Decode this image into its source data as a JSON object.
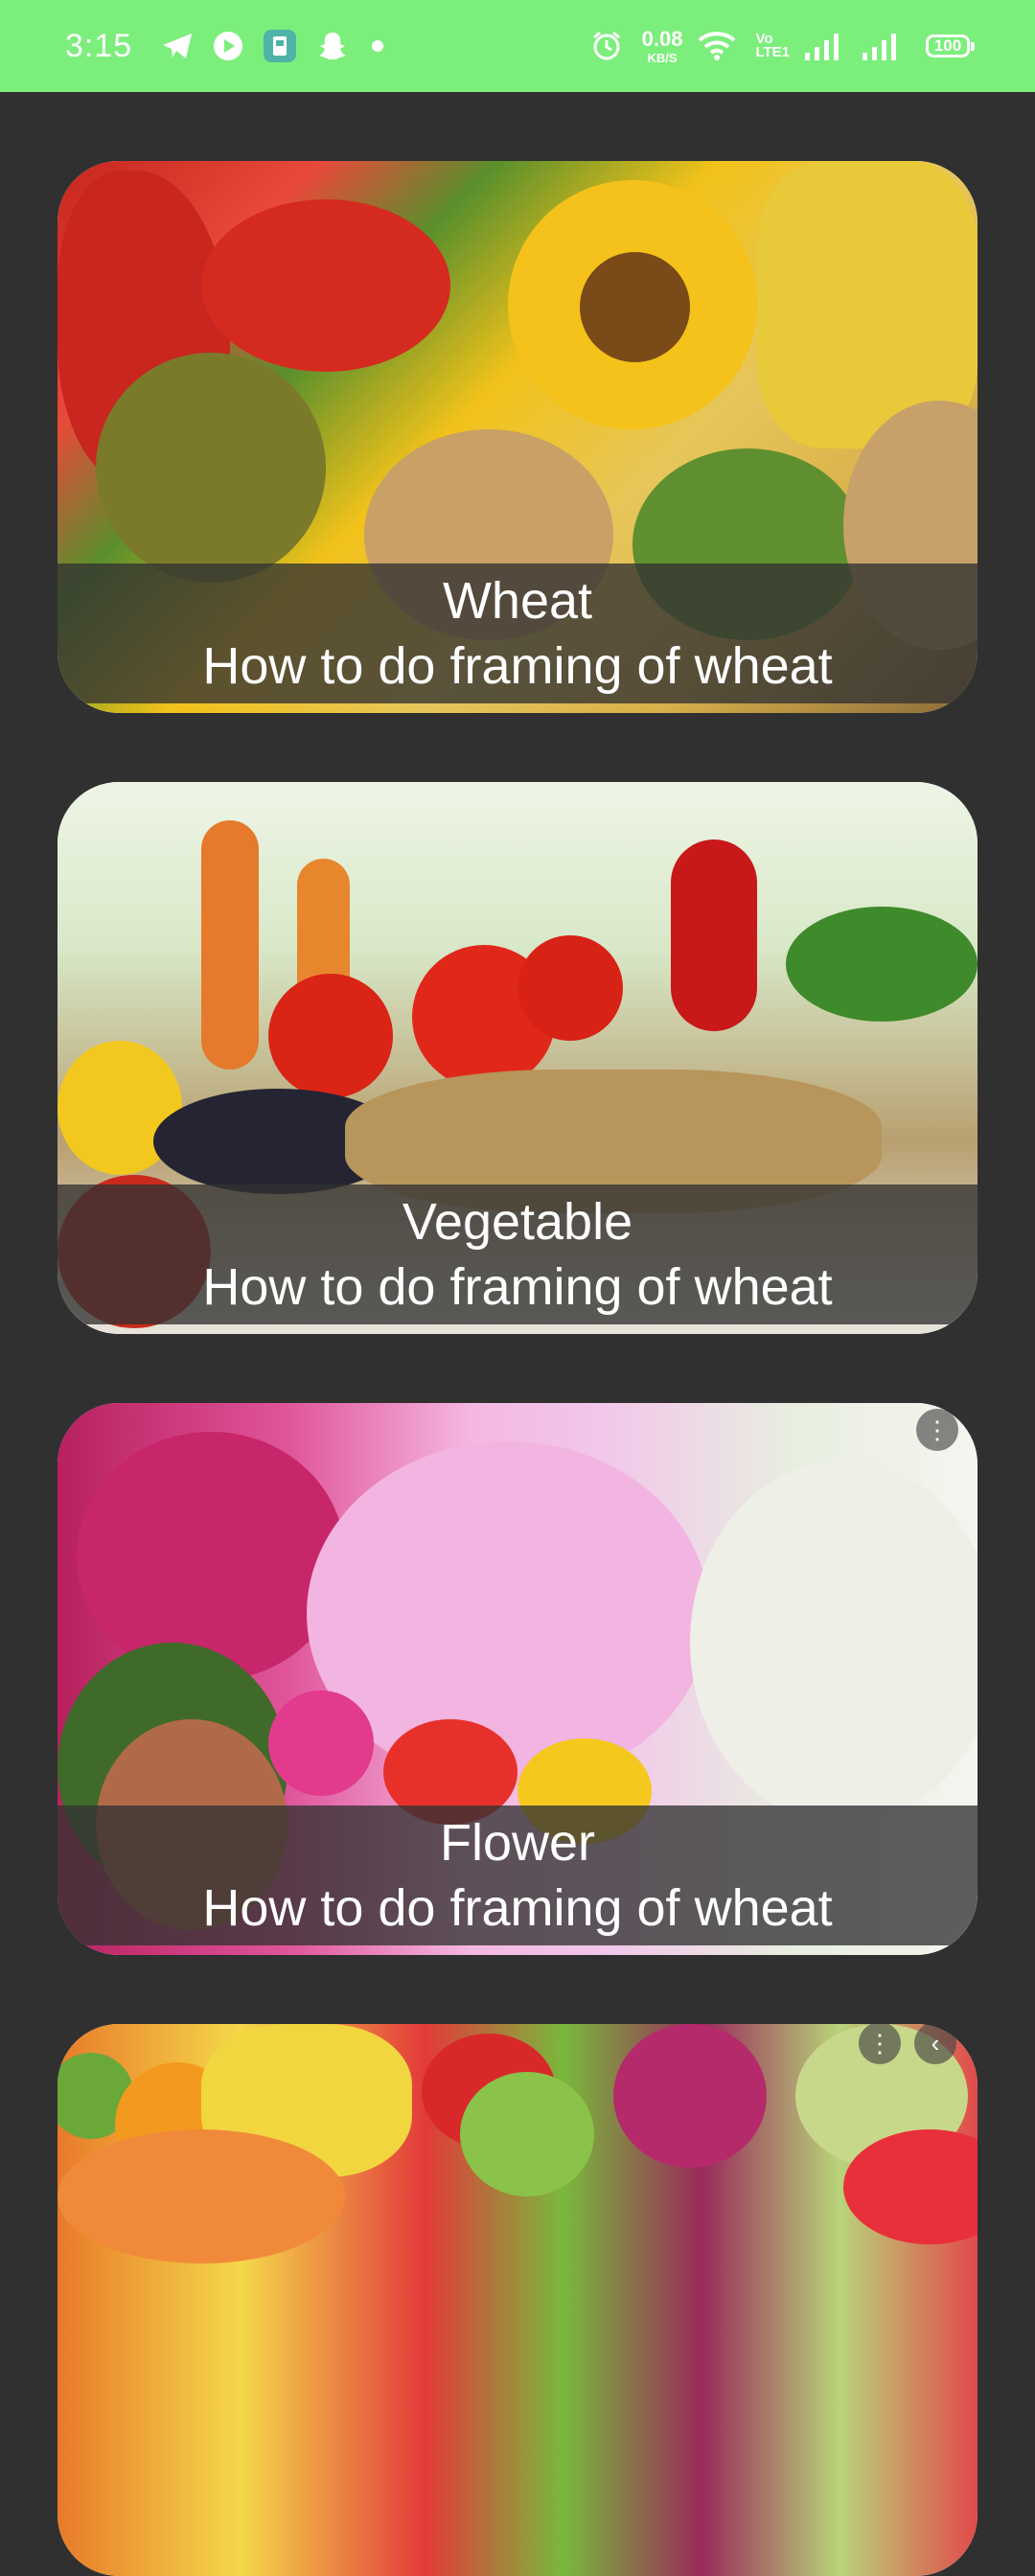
{
  "status_bar": {
    "time": "3:15",
    "net_speed_value": "0.08",
    "net_speed_unit": "KB/S",
    "volte_line1": "Vo",
    "volte_line2": "LTE1",
    "battery": "100",
    "icons": [
      "telegram-icon",
      "play-icon",
      "sim-toolkit-icon",
      "snapchat-icon",
      "notification-dot-icon",
      "alarm-icon",
      "wifi-icon",
      "signal-icon",
      "signal-icon",
      "battery-icon"
    ]
  },
  "cards": [
    {
      "title": "Wheat",
      "subtitle": "How to do framing of wheat",
      "image": "crops-collage-image",
      "colors": [
        "#c8261e",
        "#f2c21a",
        "#b58a4a",
        "#6b8a2c",
        "#d9b14a"
      ]
    },
    {
      "title": "Vegetable",
      "subtitle": "How to do framing of wheat",
      "image": "vegetable-basket-image",
      "colors": [
        "#d92416",
        "#e58a2c",
        "#3f8a2a",
        "#2a2a3a",
        "#f2d21e"
      ]
    },
    {
      "title": "Flower",
      "subtitle": "How to do framing of wheat",
      "image": "flower-garden-image",
      "colors": [
        "#e23a8c",
        "#f4a6d8",
        "#ffffff",
        "#f5d21e",
        "#3f7a2a"
      ]
    },
    {
      "title": "",
      "subtitle": "",
      "image": "fruits-assortment-image",
      "colors": [
        "#f28a1e",
        "#f5e04a",
        "#7ab83c",
        "#e23a4a",
        "#9a2a5a"
      ]
    }
  ]
}
